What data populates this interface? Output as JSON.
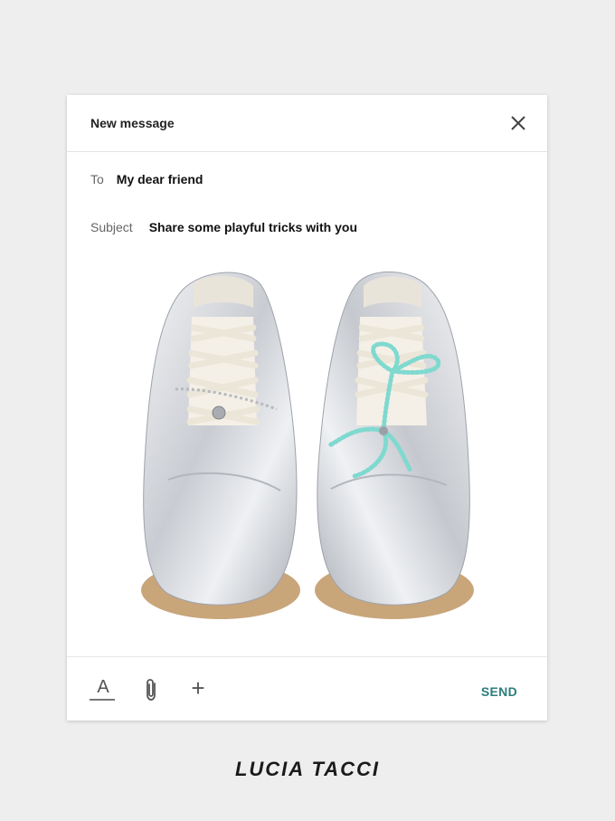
{
  "compose": {
    "title": "New message",
    "to_label": "To",
    "to_value": "My dear friend",
    "subject_label": "Subject",
    "subject_value": "Share some playful tricks with you"
  },
  "toolbar": {
    "text_format_label": "A",
    "add_label": "+",
    "send_label": "SEND"
  },
  "icons": {
    "close": "close-icon",
    "attach": "paperclip-icon",
    "format": "text-format-icon",
    "add": "plus-icon"
  },
  "colors": {
    "send": "#2e7d7d",
    "lace_mint": "#7fd9cf",
    "shoe_silver": "#d6d9de",
    "sole": "#c9a57a"
  },
  "brand": "LUCIA TACCI"
}
